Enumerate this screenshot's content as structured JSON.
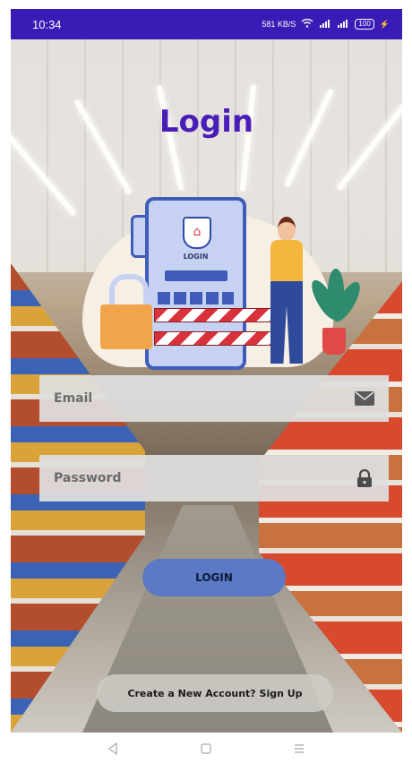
{
  "status_bar": {
    "time": "10:34",
    "net_speed": "581 KB/S",
    "battery": "100"
  },
  "login": {
    "title": "Login",
    "illustration_label": "LOGIN",
    "email_placeholder": "Email",
    "password_placeholder": "Password",
    "login_button": "LOGIN",
    "signup_link": "Create a New Account? Sign Up"
  },
  "icons": {
    "email": "envelope-icon",
    "password": "lock-icon",
    "nav_back": "back-triangle-icon",
    "nav_home": "home-square-icon",
    "nav_recent": "menu-lines-icon"
  },
  "colors": {
    "status_bar": "#3a1bb5",
    "title": "#4a1db8",
    "button": "#5b79c4",
    "field": "#dedede"
  }
}
